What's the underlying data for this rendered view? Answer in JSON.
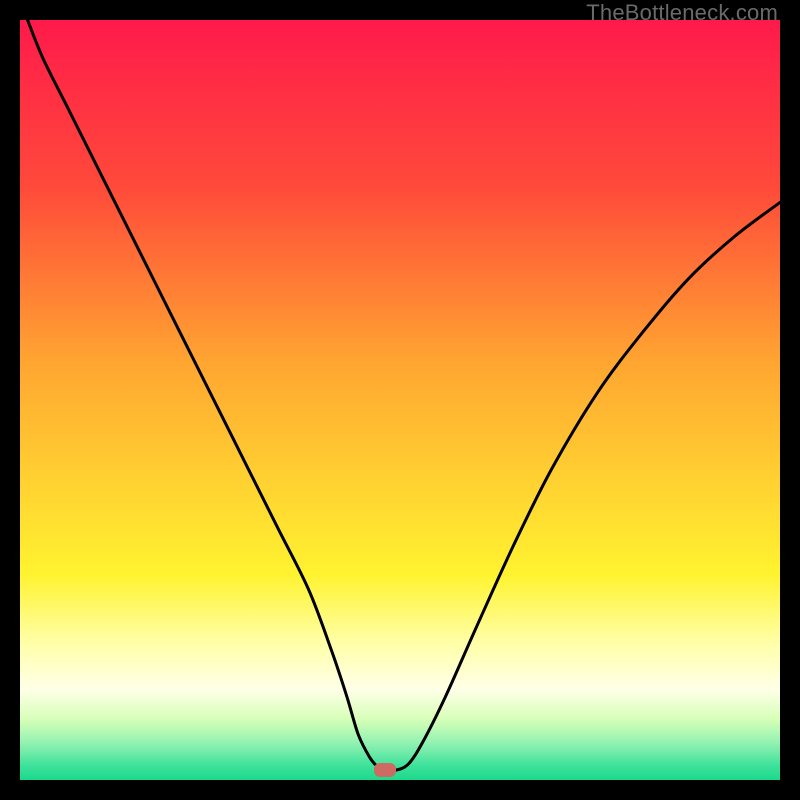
{
  "watermark": {
    "text": "TheBottleneck.com"
  },
  "chart_data": {
    "type": "line",
    "title": "",
    "xlabel": "",
    "ylabel": "",
    "xlim": [
      0,
      100
    ],
    "ylim": [
      0,
      100
    ],
    "gradient_stops": [
      {
        "offset": 0,
        "color": "#ff1a4b"
      },
      {
        "offset": 0.22,
        "color": "#ff4a3a"
      },
      {
        "offset": 0.45,
        "color": "#ffa531"
      },
      {
        "offset": 0.62,
        "color": "#ffd531"
      },
      {
        "offset": 0.73,
        "color": "#fff330"
      },
      {
        "offset": 0.82,
        "color": "#ffffa8"
      },
      {
        "offset": 0.88,
        "color": "#ffffe8"
      },
      {
        "offset": 0.92,
        "color": "#d7ffb8"
      },
      {
        "offset": 0.955,
        "color": "#89f0b0"
      },
      {
        "offset": 0.98,
        "color": "#40e29b"
      },
      {
        "offset": 1.0,
        "color": "#1ad98c"
      }
    ],
    "series": [
      {
        "name": "bottleneck-curve",
        "x": [
          1,
          3,
          6,
          10,
          14,
          18,
          22,
          26,
          30,
          34,
          38,
          41,
          43,
          44.5,
          46,
          47,
          48,
          49,
          51,
          53,
          56,
          60,
          65,
          70,
          76,
          82,
          88,
          94,
          100
        ],
        "y": [
          100,
          95,
          89,
          81,
          73,
          65,
          57,
          49,
          41,
          33,
          25,
          17,
          11,
          6,
          3,
          1.8,
          1.2,
          1.2,
          2,
          5,
          11,
          20,
          31,
          41,
          51,
          59,
          66,
          71.5,
          76
        ]
      }
    ],
    "marker": {
      "x": 48,
      "y": 1.3,
      "color": "#cd6b62"
    }
  }
}
